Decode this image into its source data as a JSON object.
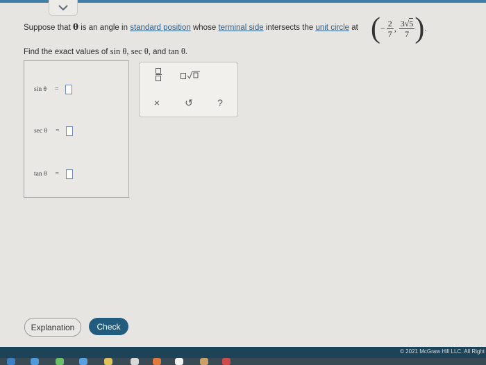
{
  "colors": {
    "accent": "#215c7e",
    "link": "#2e5e8c",
    "footer": "#1d4358"
  },
  "problem": {
    "prefix": "Suppose that",
    "theta": "θ",
    "mid1": "is an angle in",
    "link_standard": "standard position",
    "mid2": "whose",
    "link_terminal": "terminal side",
    "mid3": "intersects the",
    "link_unit": "unit circle",
    "mid4": "at",
    "point_x_sign": "−",
    "point_x_num": "2",
    "point_x_den": "7",
    "point_y_coef": "3",
    "point_y_radicand": "5",
    "point_y_den": "7",
    "comma": ",",
    "period": "."
  },
  "instruction": {
    "text": "Find the exact values of",
    "f1": "sin θ,",
    "f2": "sec θ,",
    "and": "and",
    "f3": "tan θ."
  },
  "answers": [
    {
      "label": "sin θ",
      "eq": "="
    },
    {
      "label": "sec θ",
      "eq": "="
    },
    {
      "label": "tan θ",
      "eq": "="
    }
  ],
  "toolbox": {
    "fraction_icon": "fraction-icon",
    "sqrt_icon": "square-root-icon",
    "clear_symbol": "×",
    "undo_symbol": "↺",
    "help_symbol": "?"
  },
  "buttons": {
    "explanation": "Explanation",
    "check": "Check"
  },
  "footer": {
    "copyright": "© 2021 McGraw Hill LLC. All Right"
  },
  "top_tab": {
    "icon": "chevron-down-icon"
  }
}
